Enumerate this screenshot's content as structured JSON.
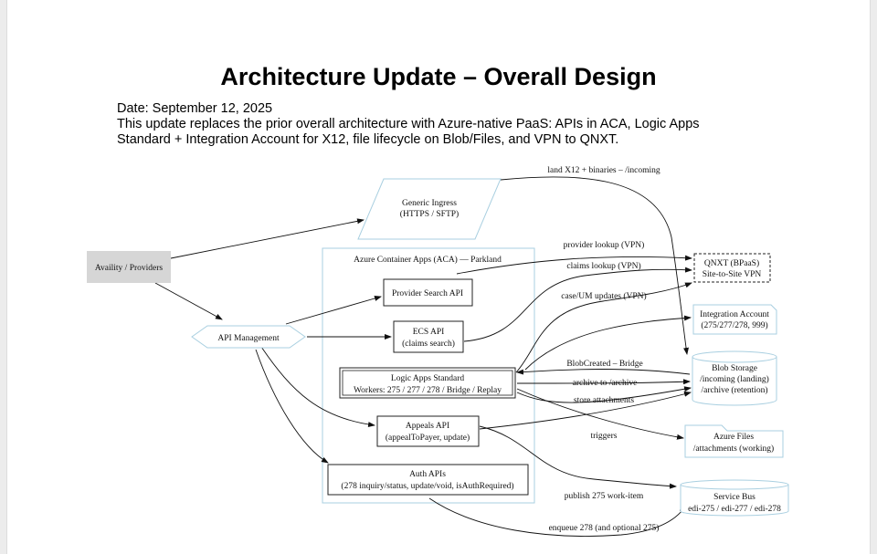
{
  "document": {
    "title": "Architecture Update – Overall Design",
    "date_line": "Date: September 12, 2025",
    "summary_line1": "This update replaces the prior overall architecture with Azure-native PaaS: APIs in ACA, Logic Apps",
    "summary_line2": "Standard + Integration Account for X12, file lifecycle on Blob/Files, and VPN to QNXT."
  },
  "diagram": {
    "cluster_label": "Azure Container Apps (ACA) — Parkland",
    "nodes": {
      "availity": "Availity / Providers",
      "ingress": [
        "Generic Ingress",
        "(HTTPS / SFTP)"
      ],
      "apim": "API Management",
      "provider_api": "Provider Search API",
      "ecs_api": [
        "ECS API",
        "(claims search)"
      ],
      "logic_apps": [
        "Logic Apps Standard",
        "Workers: 275 / 277 / 278 / Bridge / Replay"
      ],
      "appeals_api": [
        "Appeals API",
        "(appealToPayer, update)"
      ],
      "auth_apis": [
        "Auth APIs",
        "(278 inquiry/status, update/void, isAuthRequired)"
      ],
      "qnxt": [
        "QNXT (BPaaS)",
        "Site-to-Site VPN"
      ],
      "integration_account": [
        "Integration Account",
        "(275/277/278, 999)"
      ],
      "blob": [
        "Blob Storage",
        "/incoming (landing)",
        "/archive (retention)"
      ],
      "files": [
        "Azure Files",
        "/attachments (working)"
      ],
      "service_bus": [
        "Service Bus",
        "edi-275 / edi-277 / edi-278"
      ]
    },
    "edge_labels": {
      "land": "land X12 + binaries – /incoming",
      "provider_lookup": "provider lookup (VPN)",
      "claims_lookup": "claims lookup (VPN)",
      "case_um": "case/UM updates (VPN)",
      "blob_created": "BlobCreated – Bridge",
      "archive": "archive to /archive",
      "store": "store attachments",
      "triggers": "triggers",
      "publish": "publish 275 work-item",
      "enqueue": "enqueue 278 (and optional 275)"
    }
  }
}
